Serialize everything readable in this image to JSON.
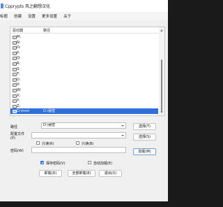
{
  "window": {
    "title": "Cpprypts 风之翻想汉化"
  },
  "menu": [
    "标题",
    "创建",
    "设置",
    "更多设置",
    "关于"
  ],
  "list": {
    "headers": {
      "drive": "驱动器",
      "path": "路径"
    },
    "rows": [
      {
        "drive": "M:",
        "path": ""
      },
      {
        "drive": "N:",
        "path": ""
      },
      {
        "drive": "O:",
        "path": ""
      },
      {
        "drive": "P:",
        "path": ""
      },
      {
        "drive": "Q:",
        "path": ""
      },
      {
        "drive": "R:",
        "path": ""
      },
      {
        "drive": "S:",
        "path": ""
      },
      {
        "drive": "T:",
        "path": ""
      },
      {
        "drive": "U:",
        "path": ""
      },
      {
        "drive": "V:",
        "path": ""
      },
      {
        "drive": "W:",
        "path": ""
      },
      {
        "drive": "X:",
        "path": ""
      },
      {
        "drive": "Y:",
        "path": ""
      },
      {
        "drive": "Z:",
        "path": ""
      },
      {
        "drive": "D:\\mnn",
        "path": "D:\\秘密"
      }
    ],
    "selected_index": 14
  },
  "form": {
    "path_label": "路径",
    "path_value": "D:\\秘密",
    "select_button": "选择(T)",
    "config_label": "配置文件",
    "config_label2": "(P)",
    "config_value": "",
    "select_button2": "选择(S)",
    "readonly_label": "只读(R)",
    "readonly_checked": false,
    "only_label": "只读(B)",
    "only_checked": false,
    "password_label": "密码(W)",
    "password_value": "",
    "encrypt_button": "加载(M)",
    "save_password_label": "保存密码(V)",
    "save_password_checked": true,
    "auto_mount_label": "自动加载(E)",
    "auto_mount_checked": false
  },
  "actions": {
    "unmount": "卸载(D)",
    "unmount_all": "全部卸载(E)",
    "exit": "退出(X)"
  }
}
